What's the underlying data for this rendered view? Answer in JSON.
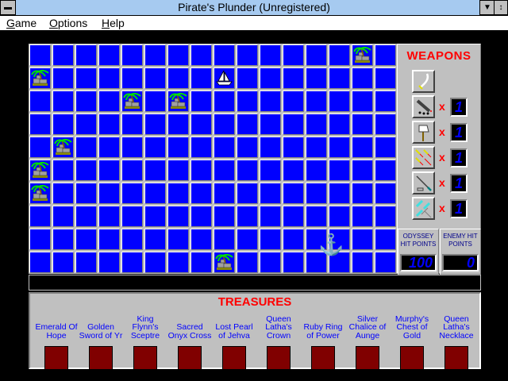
{
  "window": {
    "title": "Pirate's Plunder (Unregistered)"
  },
  "menu": [
    {
      "label": "Game",
      "key": "G",
      "rest": "ame"
    },
    {
      "label": "Options",
      "key": "O",
      "rest": "ptions"
    },
    {
      "label": "Help",
      "key": "H",
      "rest": "elp"
    }
  ],
  "board": {
    "cols": 16,
    "rows": 10,
    "islands": [
      [
        0,
        14
      ],
      [
        1,
        0
      ],
      [
        2,
        4
      ],
      [
        2,
        6
      ],
      [
        4,
        1
      ],
      [
        5,
        0
      ],
      [
        6,
        0
      ],
      [
        9,
        8
      ]
    ],
    "ship": [
      1,
      8
    ]
  },
  "weapons": {
    "title": "WEAPONS",
    "items": [
      {
        "name": "cutlass",
        "count": null
      },
      {
        "name": "cannon",
        "count": "1"
      },
      {
        "name": "axe",
        "count": "1"
      },
      {
        "name": "fire-arrows",
        "count": "1"
      },
      {
        "name": "harpoon",
        "count": "1"
      },
      {
        "name": "daggers",
        "count": "1"
      }
    ],
    "multiplier": "x"
  },
  "hit_points": {
    "odyssey_label": "ODYSSEY HIT POINTS",
    "odyssey_value": "100",
    "enemy_label": "ENEMY HIT POINTS",
    "enemy_value": "0"
  },
  "status": "",
  "treasures": {
    "title": "TREASURES",
    "items": [
      "Emerald Of Hope",
      "Golden Sword of Yr",
      "King Flynn's Sceptre",
      "Sacred Onyx Cross",
      "Lost Pearl of Jehva",
      "Queen Latha's Crown",
      "Ruby Ring of Power",
      "Silver Chalice of Aunge",
      "Murphy's Chest of Gold",
      "Queen Latha's Necklace"
    ]
  },
  "colors": {
    "sea": "#0000ff",
    "panel": "#c0c0c0",
    "title": "#ff0000",
    "treasure_box": "#800000"
  }
}
